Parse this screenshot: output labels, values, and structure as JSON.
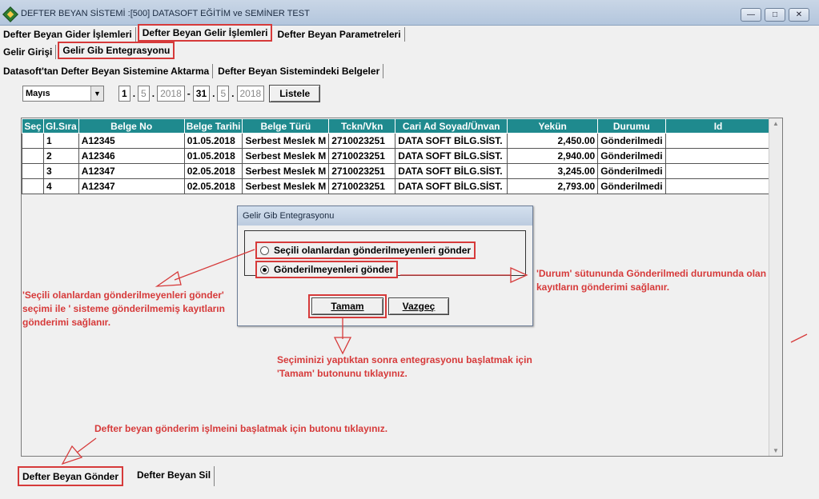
{
  "window": {
    "title": "DEFTER BEYAN SİSTEMİ :[500]  DATASOFT EĞİTİM ve SEMİNER TEST",
    "min": "—",
    "max": "□",
    "close": "✕"
  },
  "main_tabs": [
    "Defter Beyan Gider İşlemleri",
    "Defter Beyan Gelir İşlemleri",
    "Defter Beyan Parametreleri"
  ],
  "sub_tabs": [
    "Gelir Girişi",
    "Gelir Gib Entegrasyonu"
  ],
  "sub_sub_tabs": [
    "Datasoft'tan Defter Beyan Sistemine Aktarma",
    "Defter Beyan Sistemindeki Belgeler"
  ],
  "filter": {
    "month": "Mayıs",
    "start_day": "1",
    "start_month": "5",
    "start_year": "2018",
    "end_day": "31",
    "end_month": "5",
    "end_year": "2018",
    "list_button": "Listele"
  },
  "grid": {
    "headers": [
      "Seç",
      "Gl.Sıra",
      "Belge No",
      "Belge Tarihi",
      "Belge Türü",
      "Tckn/Vkn",
      "Cari Ad Soyad/Ünvan",
      "Yekün",
      "Durumu",
      "Id"
    ],
    "rows": [
      [
        "",
        "1",
        "A12345",
        "01.05.2018",
        "Serbest Meslek M",
        "2710023251",
        "DATA SOFT BİLG.SİST.",
        "2,450.00",
        "Gönderilmedi",
        ""
      ],
      [
        "",
        "2",
        "A12346",
        "01.05.2018",
        "Serbest Meslek M",
        "2710023251",
        "DATA SOFT BİLG.SİST.",
        "2,940.00",
        "Gönderilmedi",
        ""
      ],
      [
        "",
        "3",
        "A12347",
        "02.05.2018",
        "Serbest Meslek M",
        "2710023251",
        "DATA SOFT BİLG.SİST.",
        "3,245.00",
        "Gönderilmedi",
        ""
      ],
      [
        "",
        "4",
        "A12347",
        "02.05.2018",
        "Serbest Meslek M",
        "2710023251",
        "DATA SOFT BİLG.SİST.",
        "2,793.00",
        "Gönderilmedi",
        ""
      ]
    ]
  },
  "dialog": {
    "title": "Gelir Gib Entegrasyonu",
    "option1": "Seçili olanlardan gönderilmeyenleri gönder",
    "option2": "Gönderilmeyenleri gönder",
    "ok": "Tamam",
    "cancel": "Vazgeç"
  },
  "annotations": {
    "left_1": "'Seçili olanlardan gönderilmeyenleri gönder'",
    "left_2": "seçimi ile ' sisteme gönderilmemiş kayıtların",
    "left_3": "gönderimi sağlanır.",
    "right_1": "'Durum' sütununda Gönderilmedi durumunda olan",
    "right_2": "kayıtların gönderimi sağlanır.",
    "center_1": "Seçiminizi yaptıktan sonra entegrasyonu başlatmak için",
    "center_2": "'Tamam' butonunu tıklayınız.",
    "bottom": "Defter beyan gönderim işlmeini başlatmak için butonu tıklayınız."
  },
  "bottom_buttons": [
    "Defter Beyan Gönder",
    "Defter Beyan Sil"
  ],
  "colors": {
    "grid_header": "#1f8a8e",
    "annotation": "#d63a3a"
  }
}
